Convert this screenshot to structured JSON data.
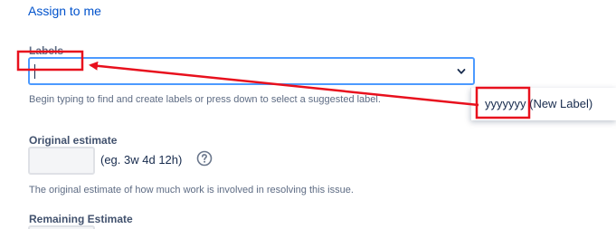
{
  "assign": {
    "label": "Assign to me"
  },
  "labels": {
    "caption": "Labels",
    "help": "Begin typing to find and create labels or press down to select a suggested label.",
    "suggestion": "yyyyyyy (New Label)"
  },
  "original_estimate": {
    "title": "Original estimate",
    "hint": "(eg. 3w 4d 12h)",
    "help": "The original estimate of how much work is involved in resolving this issue."
  },
  "remaining_estimate": {
    "title": "Remaining Estimate"
  },
  "colors": {
    "link": "#0052cc",
    "focus_border": "#4c9aff",
    "annotation": "#e8101d"
  },
  "icons": {
    "dropdown": "chevron-down-icon",
    "help": "question-circle-icon"
  }
}
